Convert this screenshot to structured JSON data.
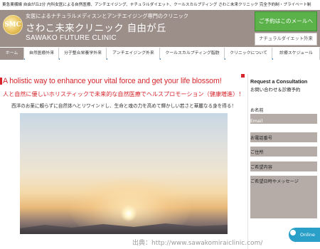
{
  "topline": "東急東横線 自由が丘2分 内科女医による自然医療、アンチエイジング、ナチュラルダイエット、クールスカルプティング さわこ未来クリニック 完全予約制・プライベート制",
  "header": {
    "logo_text": "SMC",
    "tagline": "女医によるナチュラルメディスンとアンチエイジング専門のクリニック",
    "clinic_name": "さわこ未来クリニック 自由が丘",
    "clinic_name_en": "SAWAKO FUTURE CLINIC",
    "mail_button": "ご予約はこのメールへ",
    "diet_link": "ナチュラルダイエット外来"
  },
  "nav": {
    "items": [
      {
        "label": "ホーム"
      },
      {
        "label": "自然医療外来"
      },
      {
        "label": "分子整合栄養学外来"
      },
      {
        "label": "アンチエイジング外来"
      },
      {
        "label": "クールスカルプティング脂肪"
      },
      {
        "label": "クリニックについて"
      },
      {
        "label": "診療スケジュール"
      }
    ]
  },
  "main": {
    "title": "A holistic way to enhance your vital force and get your life blossom!",
    "subtitle": "人と自然に優しいホリスティックで未来的な自然医療でヘルスプロモーション（健康増進）！",
    "lead": "西洋のお薬に頼らずに自然体へとリワインドし、生命と魂の力を高めて輝かしい若さと華麗なる身を得る！"
  },
  "sidebar": {
    "heading": "Request a Consultation",
    "heading_jp": "お問い合わせ＆診療予約",
    "fields": [
      {
        "label": "お名前"
      },
      {
        "label": "Email"
      },
      {
        "label": "お電話番号"
      },
      {
        "label": "ご住所"
      },
      {
        "label": "ご希望内容"
      },
      {
        "label": "ご希望日時やメッセージ"
      }
    ],
    "chat_label": "Online"
  },
  "source": "出典：http://www.sawakomiraiclinic.com/",
  "colors": {
    "header_bg": "#9c8f8a",
    "accent_red": "#d6252b",
    "mail_green": "#5bb24a",
    "nav_blue": "#4c8ec6"
  }
}
